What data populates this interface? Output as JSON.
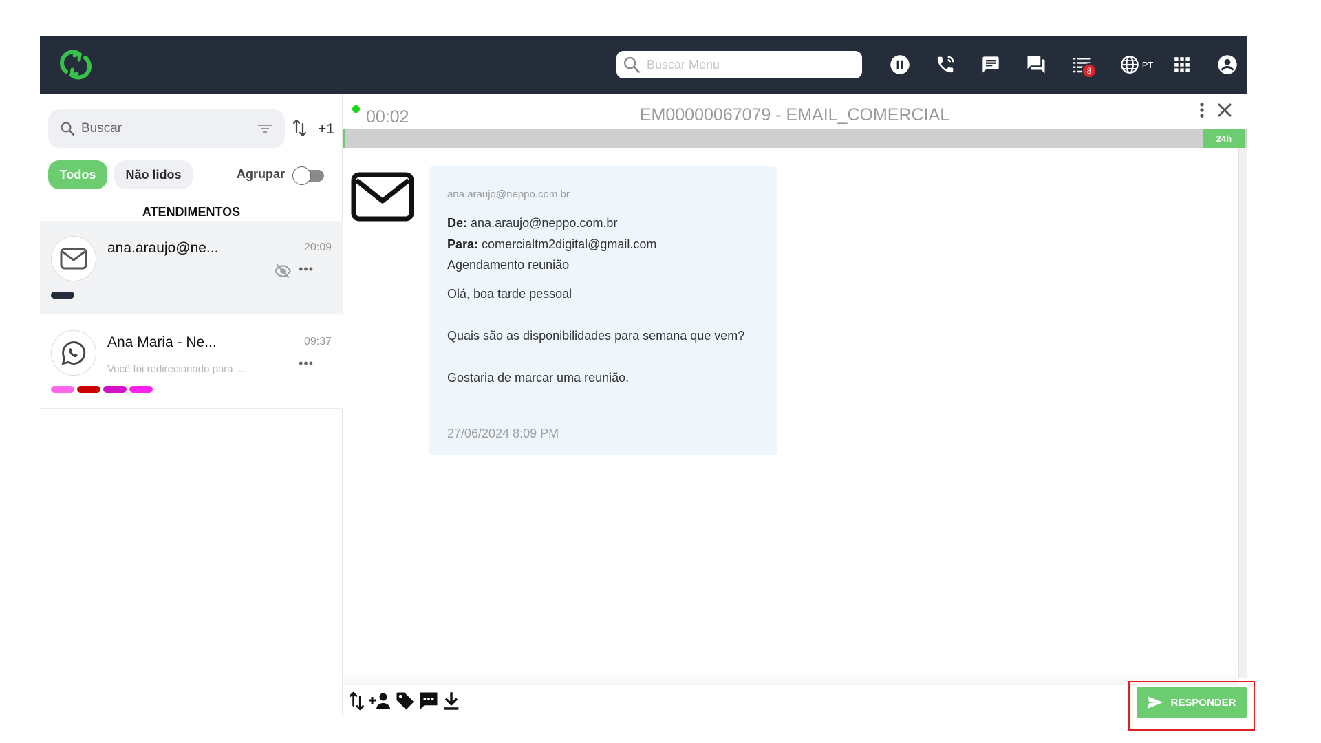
{
  "header": {
    "search_placeholder": "Buscar Menu",
    "tasks_badge": "8",
    "language": "PT",
    "icons": [
      "pause-icon",
      "phone-icon",
      "message-icon",
      "chat-icon",
      "task-list-icon",
      "globe-icon",
      "apps-grid-icon",
      "account-icon"
    ]
  },
  "left": {
    "search_placeholder": "Buscar",
    "plus_one": "+1",
    "filters": {
      "all": "Todos",
      "unread": "Não lidos"
    },
    "group_label": "Agrupar",
    "group_enabled": false,
    "section_title": "ATENDIMENTOS",
    "conversations": [
      {
        "name": "ana.araujo@ne...",
        "time": "20:09",
        "preview": "",
        "channel": "email",
        "tags": [
          "#252c3a"
        ]
      },
      {
        "name": "Ana Maria - Ne...",
        "time": "09:37",
        "preview": "Você foi redirecionado para ...",
        "channel": "whatsapp",
        "tags": [
          "#ff66e8",
          "#cc0000",
          "#d40fc8",
          "#ff22ee"
        ]
      }
    ]
  },
  "chat": {
    "timer": "00:02",
    "title": "EM00000067079 - EMAIL_COMERCIAL",
    "sla_label": "24h",
    "message": {
      "sender": "ana.araujo@neppo.com.br",
      "from_label": "De:",
      "from": "ana.araujo@neppo.com.br",
      "to_label": "Para:",
      "to": "comercialtm2digital@gmail.com",
      "subject": "Agendamento reunião",
      "body": [
        "Olá, boa tarde pessoal",
        "Quais são as disponibilidades para semana que vem?",
        "Gostaria de marcar uma reunião."
      ],
      "date": "27/06/2024 8:09 PM"
    },
    "toolbar_icons": [
      "transfer-icon",
      "add-participant-icon",
      "tag-icon",
      "template-message-icon",
      "download-icon"
    ],
    "reply_label": "RESPONDER"
  },
  "colors": {
    "topbar": "#252c3a",
    "accent": "#6bcd6f",
    "highlight": "#e02020"
  }
}
